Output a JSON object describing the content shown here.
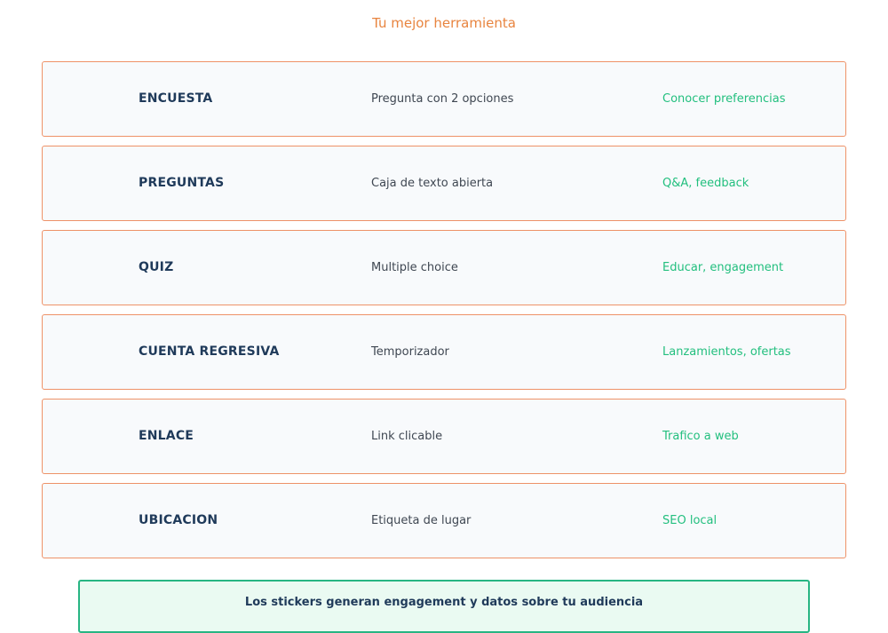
{
  "header": {
    "title": "Tu mejor herramienta"
  },
  "rows": [
    {
      "name": "ENCUESTA",
      "description": "Pregunta con 2 opciones",
      "use": "Conocer preferencias"
    },
    {
      "name": "PREGUNTAS",
      "description": "Caja de texto abierta",
      "use": "Q&A, feedback"
    },
    {
      "name": "QUIZ",
      "description": "Multiple choice",
      "use": "Educar, engagement"
    },
    {
      "name": "CUENTA REGRESIVA",
      "description": "Temporizador",
      "use": "Lanzamientos, ofertas"
    },
    {
      "name": "ENLACE",
      "description": "Link clicable",
      "use": "Trafico a web"
    },
    {
      "name": "UBICACION",
      "description": "Etiqueta de lugar",
      "use": "SEO local"
    }
  ],
  "footer": {
    "note": "Los stickers generan engagement y datos sobre tu audiencia"
  },
  "colors": {
    "accent_orange": "#e8843f",
    "border_orange": "#ee9268",
    "accent_green": "#22bf7e",
    "title_navy": "#1f3a5a"
  }
}
